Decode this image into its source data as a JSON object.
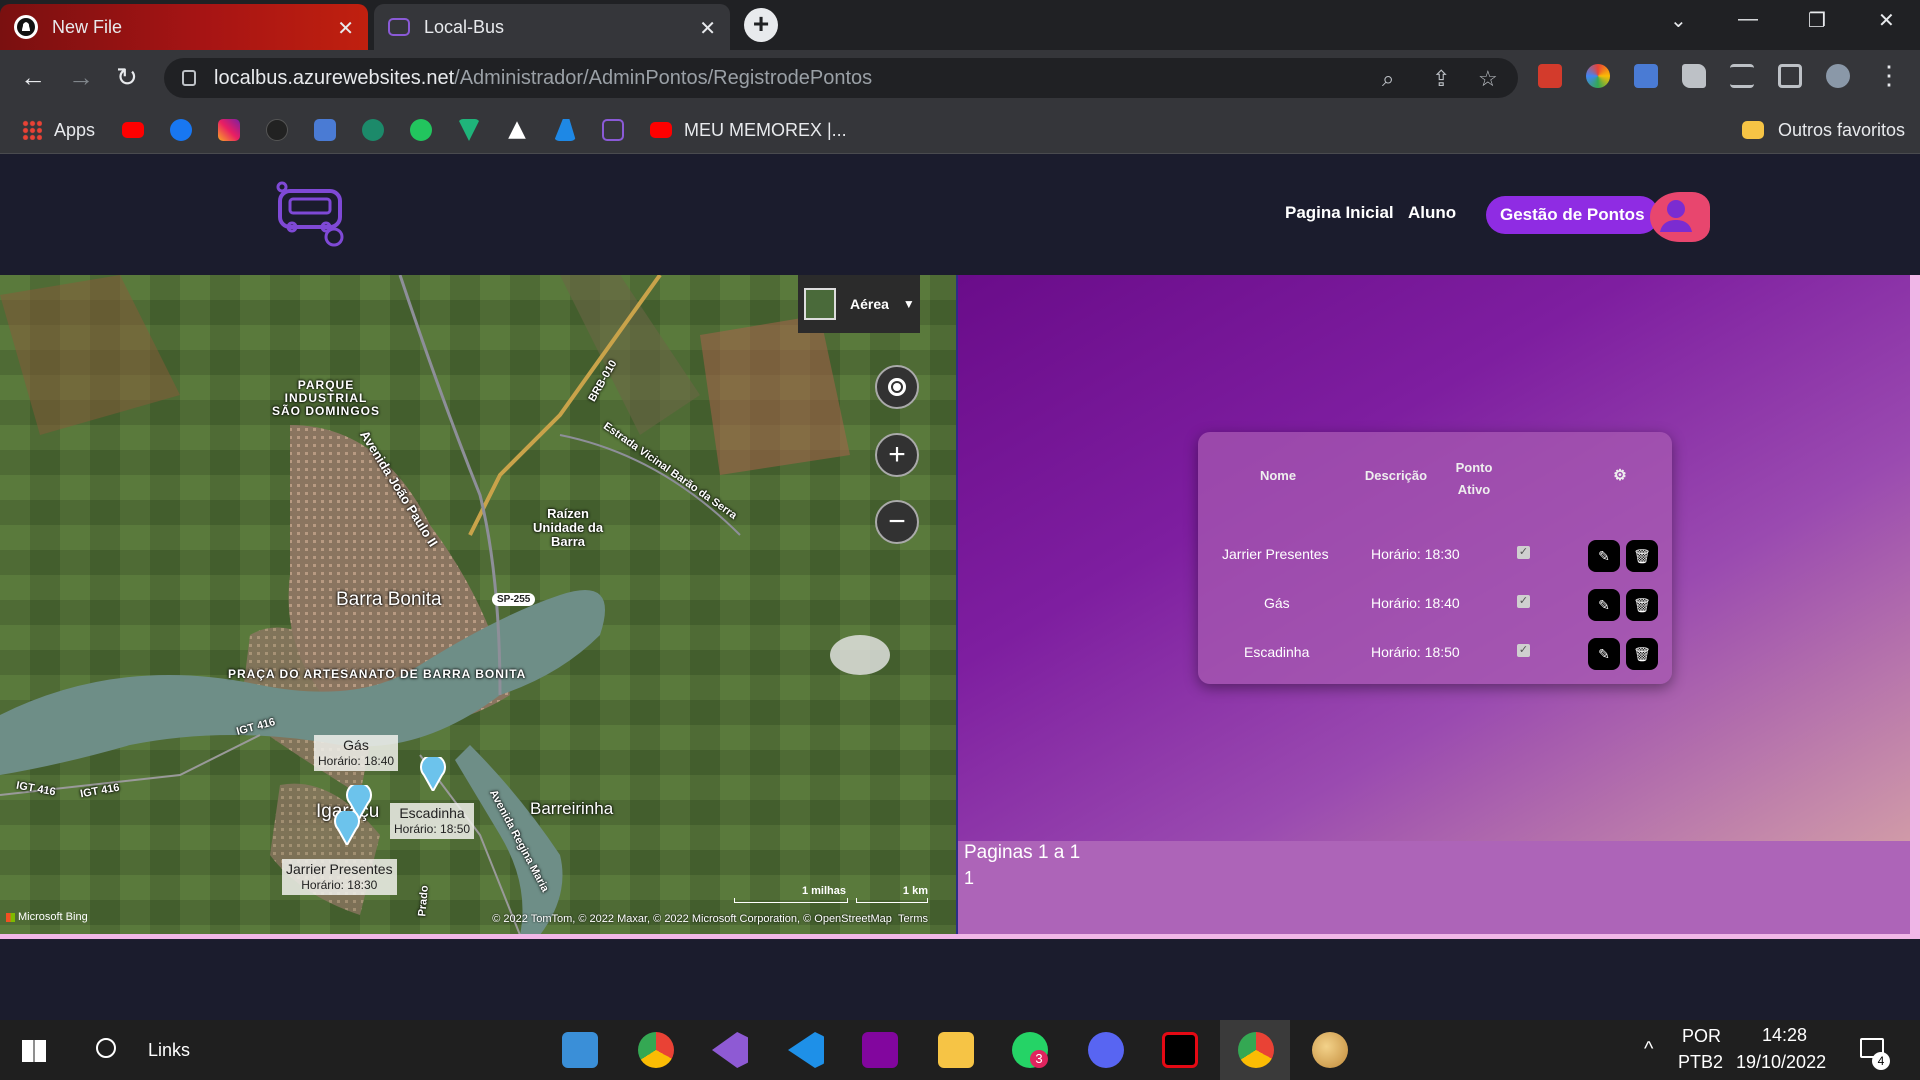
{
  "browser": {
    "tabs": [
      {
        "title": "New File",
        "icon": "github-icon"
      },
      {
        "title": "Local-Bus",
        "icon": "localbus-icon"
      }
    ],
    "url_host": "localbus.azurewebsites.net",
    "url_path": "/Administrador/AdminPontos/RegistrodePontos",
    "bookmarks": {
      "apps": "Apps",
      "memorex": "MEU MEMOREX |...",
      "outros": "Outros favoritos"
    }
  },
  "site": {
    "nav": {
      "home": "Pagina Inicial",
      "aluno": "Aluno",
      "gestao": "Gestão de Pontos"
    }
  },
  "map": {
    "style_label": "Aérea",
    "places": {
      "parque": [
        "PARQUE",
        "INDUSTRIAL",
        "SÃO DOMINGOS"
      ],
      "barra_bonita": "Barra Bonita",
      "praca": "PRAÇA DO ARTESANATO DE BARRA BONITA",
      "raizen": [
        "Raízen",
        "Unidade da",
        "Barra"
      ],
      "barreirinha": "Barreirinha",
      "igaracu": "Igaraçu",
      "brb": "BRB-010",
      "sp255": "SP-255",
      "igt1": "IGT 416",
      "igt2": "IGT 416",
      "igt3": "IGT 416",
      "estrada": "Estrada Vicinal Barão da Serra",
      "avenida": "Avenida João Paulo II",
      "avenida2": "Avenida Regina Maria",
      "prado": "Prado"
    },
    "pins": [
      {
        "name": "Gás",
        "hour": "Horário: 18:40"
      },
      {
        "name": "Escadinha",
        "hour": "Horário: 18:50"
      },
      {
        "name": "Jarrier Presentes",
        "hour": "Horário: 18:30"
      }
    ],
    "scale_mi": "1 milhas",
    "scale_km": "1 km",
    "copyright": "© 2022 TomTom, © 2022 Maxar, © 2022 Microsoft Corporation, © OpenStreetMap",
    "terms": "Terms",
    "bing": "Microsoft Bing"
  },
  "table": {
    "headers": {
      "nome": "Nome",
      "descricao": "Descrição",
      "ponto": "Ponto",
      "ativo": "Ativo",
      "settings": "⚙"
    },
    "rows": [
      {
        "nome": "Jarrier Presentes",
        "descricao": "Horário: 18:30",
        "ativo": true
      },
      {
        "nome": "Gás",
        "descricao": "Horário: 18:40",
        "ativo": true
      },
      {
        "nome": "Escadinha",
        "descricao": "Horário: 18:50",
        "ativo": true
      }
    ]
  },
  "pager": {
    "summary": "Paginas 1 a 1",
    "page": "1"
  },
  "taskbar": {
    "search": "Links",
    "lang": "POR",
    "layout": "PTB2",
    "time": "14:28",
    "date": "19/10/2022",
    "whatsapp_badge": "3",
    "notif_badge": "4"
  }
}
